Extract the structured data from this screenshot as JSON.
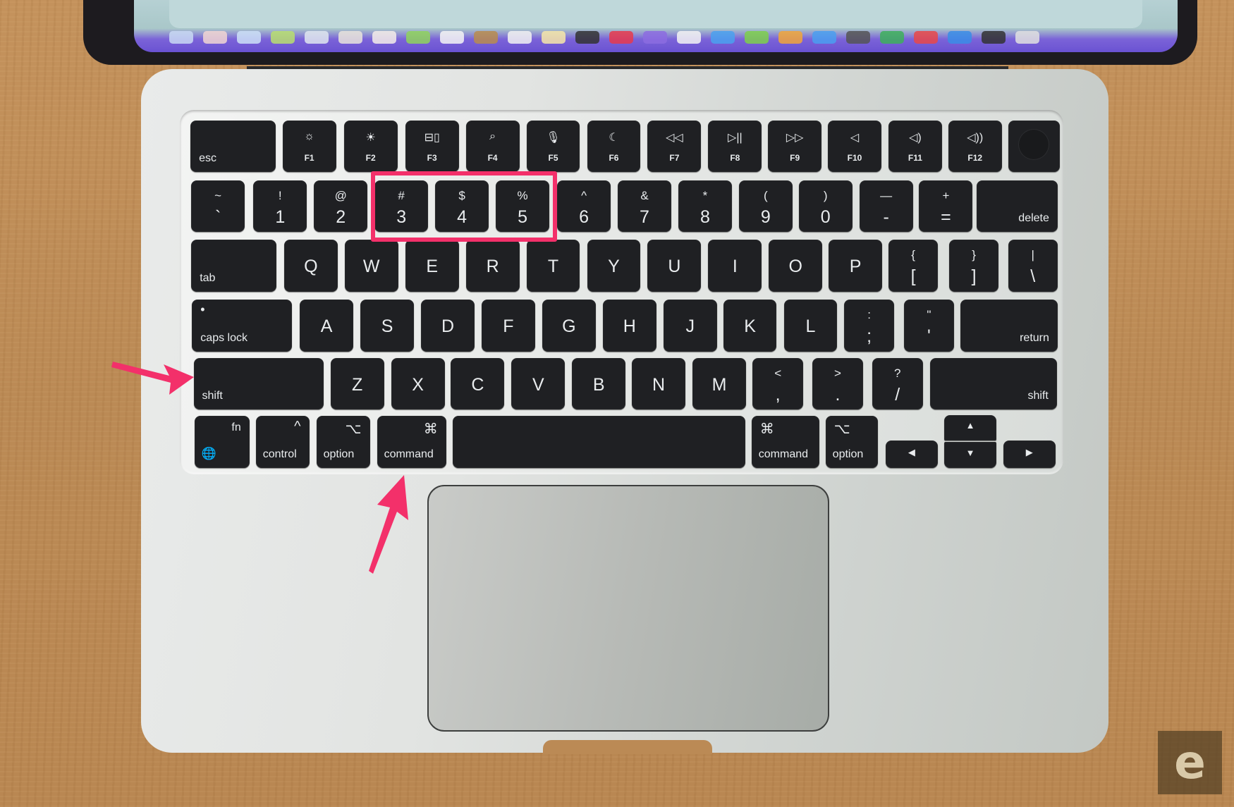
{
  "scene": {
    "description": "Top-down photo of a MacBook Air keyboard with Shift, Command and the 3/4/5 keys highlighted (screenshot shortcut)",
    "accent_color": "#f3306a",
    "watermark": "e"
  },
  "function_row": [
    {
      "sub": "esc",
      "icon": ""
    },
    {
      "sub": "F1",
      "icon": "☼"
    },
    {
      "sub": "F2",
      "icon": "☀"
    },
    {
      "sub": "F3",
      "icon": "⊟▯"
    },
    {
      "sub": "F4",
      "icon": "⌕"
    },
    {
      "sub": "F5",
      "icon": "🎙"
    },
    {
      "sub": "F6",
      "icon": "☾"
    },
    {
      "sub": "F7",
      "icon": "◁◁"
    },
    {
      "sub": "F8",
      "icon": "▷||"
    },
    {
      "sub": "F9",
      "icon": "▷▷"
    },
    {
      "sub": "F10",
      "icon": "◁"
    },
    {
      "sub": "F11",
      "icon": "◁)"
    },
    {
      "sub": "F12",
      "icon": "◁))"
    },
    {
      "sub": "",
      "icon": "touch-id"
    }
  ],
  "number_row": [
    {
      "top": "~",
      "main": "`"
    },
    {
      "top": "!",
      "main": "1"
    },
    {
      "top": "@",
      "main": "2"
    },
    {
      "top": "#",
      "main": "3"
    },
    {
      "top": "$",
      "main": "4"
    },
    {
      "top": "%",
      "main": "5"
    },
    {
      "top": "^",
      "main": "6"
    },
    {
      "top": "&",
      "main": "7"
    },
    {
      "top": "*",
      "main": "8"
    },
    {
      "top": "(",
      "main": "9"
    },
    {
      "top": ")",
      "main": "0"
    },
    {
      "top": "—",
      "main": "-"
    },
    {
      "top": "+",
      "main": "="
    },
    {
      "label": "delete"
    }
  ],
  "qwerty_row": [
    {
      "label": "tab"
    },
    {
      "main": "Q"
    },
    {
      "main": "W"
    },
    {
      "main": "E"
    },
    {
      "main": "R"
    },
    {
      "main": "T"
    },
    {
      "main": "Y"
    },
    {
      "main": "U"
    },
    {
      "main": "I"
    },
    {
      "main": "O"
    },
    {
      "main": "P"
    },
    {
      "top": "{",
      "main": "["
    },
    {
      "top": "}",
      "main": "]"
    },
    {
      "top": "|",
      "main": "\\"
    }
  ],
  "home_row": [
    {
      "label": "caps lock",
      "dot": "•"
    },
    {
      "main": "A"
    },
    {
      "main": "S"
    },
    {
      "main": "D"
    },
    {
      "main": "F"
    },
    {
      "main": "G"
    },
    {
      "main": "H"
    },
    {
      "main": "J"
    },
    {
      "main": "K"
    },
    {
      "main": "L"
    },
    {
      "top": ":",
      "main": ";"
    },
    {
      "top": "\"",
      "main": "'"
    },
    {
      "label": "return"
    }
  ],
  "shift_row": [
    {
      "label": "shift"
    },
    {
      "main": "Z"
    },
    {
      "main": "X"
    },
    {
      "main": "C"
    },
    {
      "main": "V"
    },
    {
      "main": "B"
    },
    {
      "main": "N"
    },
    {
      "main": "M"
    },
    {
      "top": "<",
      "main": ","
    },
    {
      "top": ">",
      "main": "."
    },
    {
      "top": "?",
      "main": "/"
    },
    {
      "label": "shift"
    }
  ],
  "bottom_row": [
    {
      "label": "fn",
      "icon": "🌐"
    },
    {
      "label": "control",
      "icon": "^"
    },
    {
      "label": "option",
      "icon": "⌥"
    },
    {
      "label": "command",
      "icon": "⌘"
    },
    {
      "label": ""
    },
    {
      "label": "command",
      "icon": "⌘"
    },
    {
      "label": "option",
      "icon": "⌥"
    },
    {
      "icon": "◀"
    },
    {
      "icon": "▲"
    },
    {
      "icon": "▼"
    },
    {
      "icon": "▶"
    }
  ],
  "highlights": {
    "boxed_keys": [
      "3",
      "4",
      "5"
    ],
    "arrow_targets": [
      "shift",
      "command"
    ]
  }
}
